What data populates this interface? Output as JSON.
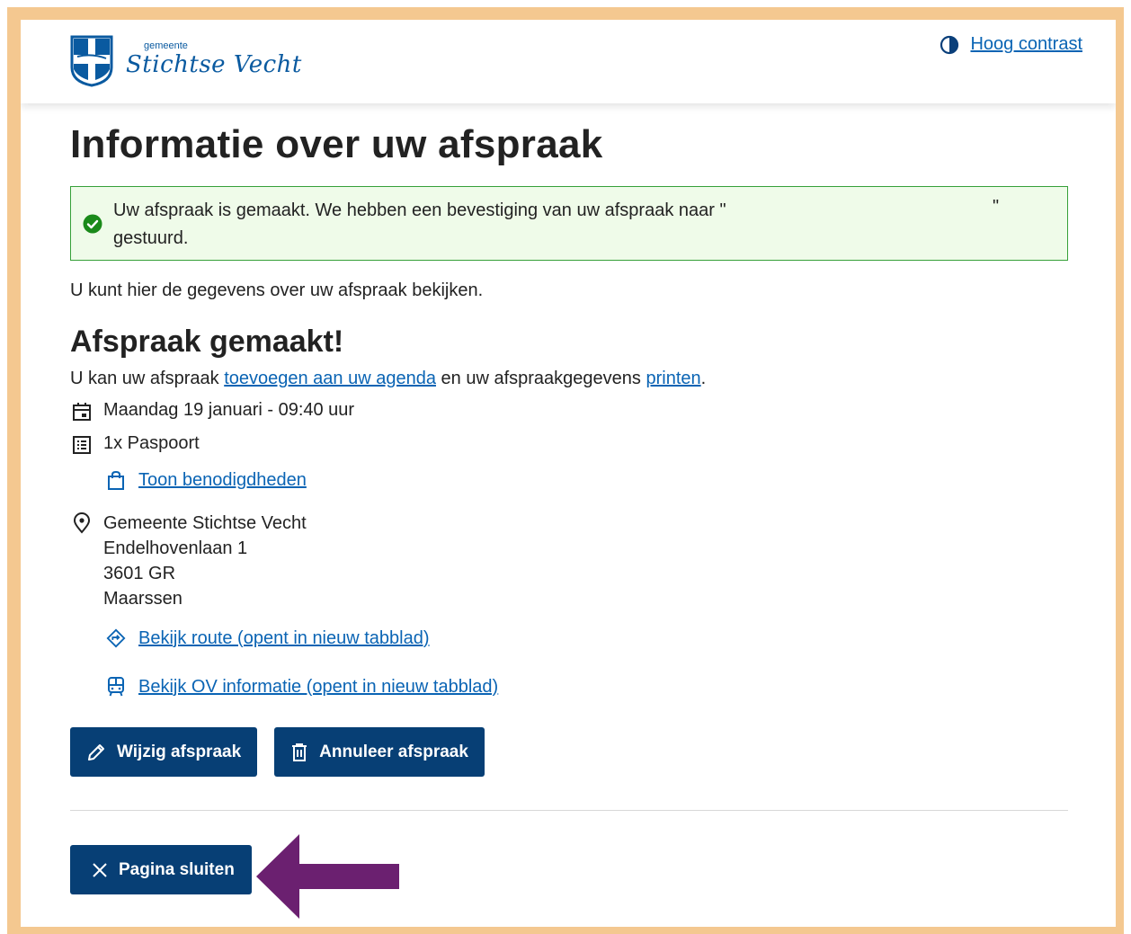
{
  "header": {
    "logo_small": "gemeente",
    "logo_big": "Stichtse Vecht",
    "contrast_label": "Hoog contrast"
  },
  "main": {
    "title": "Informatie over uw afspraak",
    "alert_line1": "Uw afspraak is gemaakt. We hebben een bevestiging van uw afspraak naar \"",
    "alert_quote_close": "\"",
    "alert_line2": "gestuurd.",
    "intro": "U kunt hier de gegevens over uw afspraak bekijken.",
    "subtitle": "Afspraak gemaakt!",
    "lead_pre": "U kan uw afspraak ",
    "lead_link1": "toevoegen aan uw agenda",
    "lead_mid": " en uw afspraakgegevens ",
    "lead_link2": "printen",
    "lead_post": ".",
    "datetime": "Maandag 19 januari - 09:40 uur",
    "product": "1x Paspoort",
    "requirements_link": "Toon benodigdheden",
    "location": {
      "name": "Gemeente Stichtse Vecht",
      "street": "Endelhovenlaan 1",
      "postcode": "3601 GR",
      "city": "Maarssen"
    },
    "route_link": "Bekijk route (opent in nieuw tabblad)",
    "ov_link": "Bekijk OV informatie (opent in nieuw tabblad)",
    "edit_button": "Wijzig afspraak",
    "cancel_button": "Annuleer afspraak",
    "close_button": "Pagina sluiten"
  },
  "colors": {
    "frame": "#f4c890",
    "primary_button": "#073f75",
    "link": "#0a64b4",
    "success_border": "#36a039",
    "success_bg": "#effbe9",
    "annotation_arrow": "#6b2070"
  }
}
